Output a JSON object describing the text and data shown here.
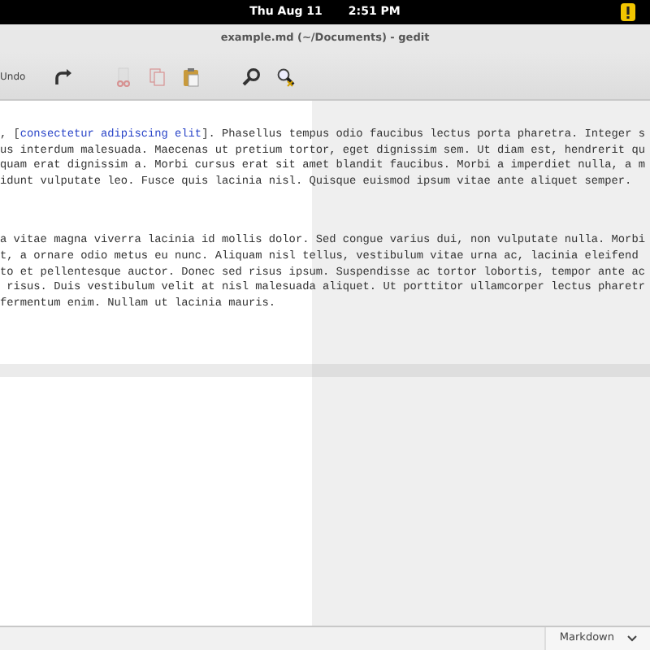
{
  "top_bar": {
    "date": "Thu Aug 11",
    "time": "2:51 PM"
  },
  "window": {
    "title": "example.md (~/Documents) - gedit"
  },
  "toolbar": {
    "undo_label": "Undo",
    "tools": [
      {
        "kind": "redo",
        "disabled": false
      },
      {
        "kind": "cut",
        "disabled": true
      },
      {
        "kind": "copy",
        "disabled": true
      },
      {
        "kind": "paste",
        "disabled": false
      },
      {
        "kind": "search",
        "disabled": false
      },
      {
        "kind": "replace",
        "disabled": false
      }
    ]
  },
  "editor": {
    "paragraphs": [
      [
        [
          {
            "kind": "plain",
            "text": ", ["
          },
          {
            "kind": "link",
            "text": "consectetur adipiscing elit"
          },
          {
            "kind": "plain",
            "text": "]. Phasellus tempus odio faucibus lectus porta pharetra. Integer s"
          }
        ],
        [
          {
            "kind": "plain",
            "text": "us interdum malesuada. Maecenas ut pretium tortor, eget dignissim sem. Ut diam est, hendrerit qu"
          }
        ],
        [
          {
            "kind": "plain",
            "text": "quam erat dignissim a. Morbi cursus erat sit amet blandit faucibus. Morbi a imperdiet nulla, a m"
          }
        ],
        [
          {
            "kind": "plain",
            "text": "idunt vulputate leo. Fusce quis lacinia nisl. Quisque euismod ipsum vitae ante aliquet semper."
          }
        ]
      ],
      [
        [
          {
            "kind": "plain",
            "text": "a vitae magna viverra lacinia id mollis dolor. Sed congue varius dui, non vulputate nulla. Morbi"
          }
        ],
        [
          {
            "kind": "plain",
            "text": "t, a ornare odio metus eu nunc. Aliquam nisl tellus, vestibulum vitae urna ac, lacinia eleifend"
          }
        ],
        [
          {
            "kind": "plain",
            "text": "to et pellentesque auctor. Donec sed risus ipsum. Suspendisse ac tortor lobortis, tempor ante ac"
          }
        ],
        [
          {
            "kind": "plain",
            "text": " risus. Duis vestibulum velit at nisl malesuada aliquet. Ut porttitor ullamcorper lectus pharetr"
          }
        ],
        [
          {
            "kind": "plain",
            "text": "fermentum enim. Nullam ut lacinia mauris."
          }
        ]
      ]
    ]
  },
  "status_bar": {
    "language": "Markdown"
  }
}
